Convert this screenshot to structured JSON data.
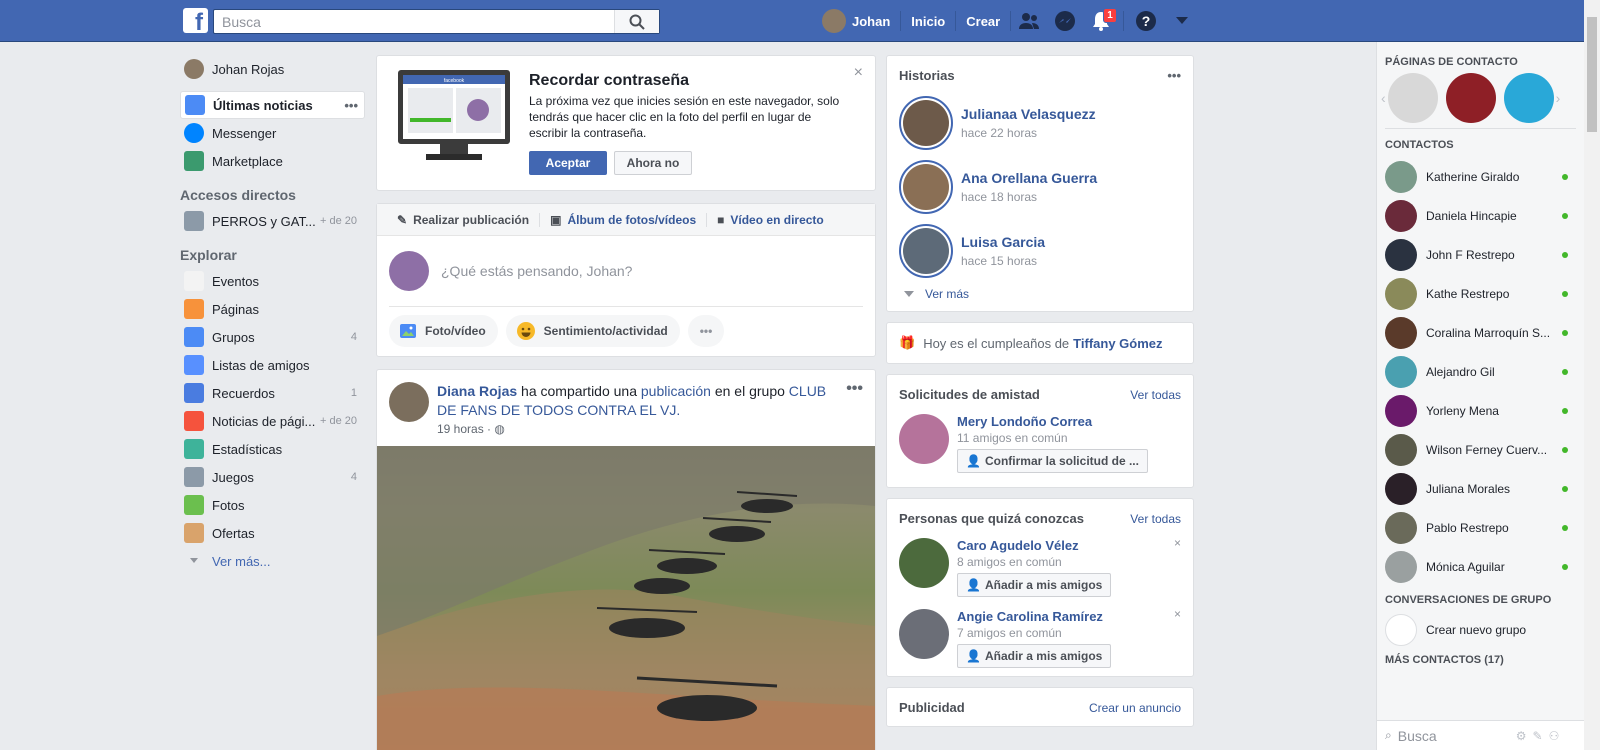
{
  "header": {
    "logo": "f",
    "search_placeholder": "Busca",
    "user_name": "Johan",
    "nav": [
      "Inicio",
      "Crear"
    ],
    "notifications_count": "1"
  },
  "left_sidebar": {
    "profile_name": "Johan Rojas",
    "main": [
      {
        "label": "Últimas noticias",
        "icon": "newsfeed-icon",
        "more": "•••"
      },
      {
        "label": "Messenger",
        "icon": "messenger-icon"
      },
      {
        "label": "Marketplace",
        "icon": "marketplace-icon"
      }
    ],
    "shortcuts_title": "Accesos directos",
    "shortcuts": [
      {
        "label": "PERROS y GAT...",
        "count": "+ de 20"
      }
    ],
    "explore_title": "Explorar",
    "explore": [
      {
        "label": "Eventos",
        "count": "",
        "icon": "calendar-icon",
        "color": "#f3f3f3"
      },
      {
        "label": "Páginas",
        "count": "",
        "icon": "flag-icon",
        "color": "#f7923b"
      },
      {
        "label": "Grupos",
        "count": "4",
        "icon": "groups-icon",
        "color": "#4c8bf5"
      },
      {
        "label": "Listas de amigos",
        "count": "",
        "icon": "friend-list-icon",
        "color": "#5890ff"
      },
      {
        "label": "Recuerdos",
        "count": "1",
        "icon": "memories-icon",
        "color": "#4a7ce0"
      },
      {
        "label": "Noticias de pági...",
        "count": "+ de 20",
        "icon": "page-feed-icon",
        "color": "#f5533d"
      },
      {
        "label": "Estadísticas",
        "count": "",
        "icon": "stats-icon",
        "color": "#3eb39a"
      },
      {
        "label": "Juegos",
        "count": "4",
        "icon": "games-icon",
        "color": "#8c9aa8"
      },
      {
        "label": "Fotos",
        "count": "",
        "icon": "photos-icon",
        "color": "#6bbf4e"
      },
      {
        "label": "Ofertas",
        "count": "",
        "icon": "offers-icon",
        "color": "#d9a36b"
      }
    ],
    "see_more": "Ver más..."
  },
  "password_card": {
    "title": "Recordar contraseña",
    "text": "La próxima vez que inicies sesión en este navegador, solo tendrás que hacer clic en la foto del perfil en lugar de escribir la contraseña.",
    "accept": "Aceptar",
    "decline": "Ahora no",
    "close": "×",
    "screen_brand": "facebook"
  },
  "composer": {
    "tabs": [
      "Realizar publicación",
      "Álbum de fotos/vídeos",
      "Vídeo en directo"
    ],
    "placeholder": "¿Qué estás pensando, Johan?",
    "actions": [
      "Foto/vídeo",
      "Sentimiento/actividad"
    ],
    "more": "•••"
  },
  "post": {
    "author": "Diana Rojas",
    "text_mid": " ha compartido una ",
    "link": "publicación",
    "text_group": " en el grupo ",
    "group": "CLUB DE FANS DE TODOS CONTRA EL VJ.",
    "time": "19 horas · ",
    "menu": "•••"
  },
  "stories": {
    "title": "Historias",
    "menu": "•••",
    "items": [
      {
        "name": "Julianaa Velasquezz",
        "time": "hace 22 horas",
        "color": "#6d5a4a"
      },
      {
        "name": "Ana Orellana Guerra",
        "time": "hace 18 horas",
        "color": "#8a6f55"
      },
      {
        "name": "Luisa Garcia",
        "time": "hace 15 horas",
        "color": "#5d6a78"
      }
    ],
    "see_more": "Ver más"
  },
  "birthday": {
    "prefix": "Hoy es el cumpleaños de",
    "name": "Tiffany Gómez"
  },
  "friend_requests": {
    "title": "Solicitudes de amistad",
    "see_all": "Ver todas",
    "items": [
      {
        "name": "Mery Londoño Correa",
        "mutual": "11 amigos en común",
        "button": "Confirmar la solicitud de ..."
      }
    ]
  },
  "pymk": {
    "title": "Personas que quizá conozcas",
    "see_all": "Ver todas",
    "items": [
      {
        "name": "Caro Agudelo Vélez",
        "mutual": "8 amigos en común",
        "button": "Añadir a mis amigos"
      },
      {
        "name": "Angie Carolina Ramírez",
        "mutual": "7 amigos en común",
        "button": "Añadir a mis amigos"
      }
    ]
  },
  "ads": {
    "title": "Publicidad",
    "action": "Crear un anuncio"
  },
  "chat": {
    "pages_title": "PÁGINAS DE CONTACTO",
    "contacts_title": "CONTACTOS",
    "contacts": [
      "Katherine Giraldo",
      "Daniela Hincapie",
      "John F Restrepo",
      "Kathe Restrepo",
      "Coralina Marroquín S...",
      "Alejandro Gil",
      "Yorleny Mena",
      "Wilson Ferney Cuerv...",
      "Juliana Morales",
      "Pablo Restrepo",
      "Mónica Aguilar"
    ],
    "group_title": "CONVERSACIONES DE GRUPO",
    "new_group": "Crear nuevo grupo",
    "more_contacts": "MÁS CONTACTOS (17)",
    "search_placeholder": "Busca"
  }
}
